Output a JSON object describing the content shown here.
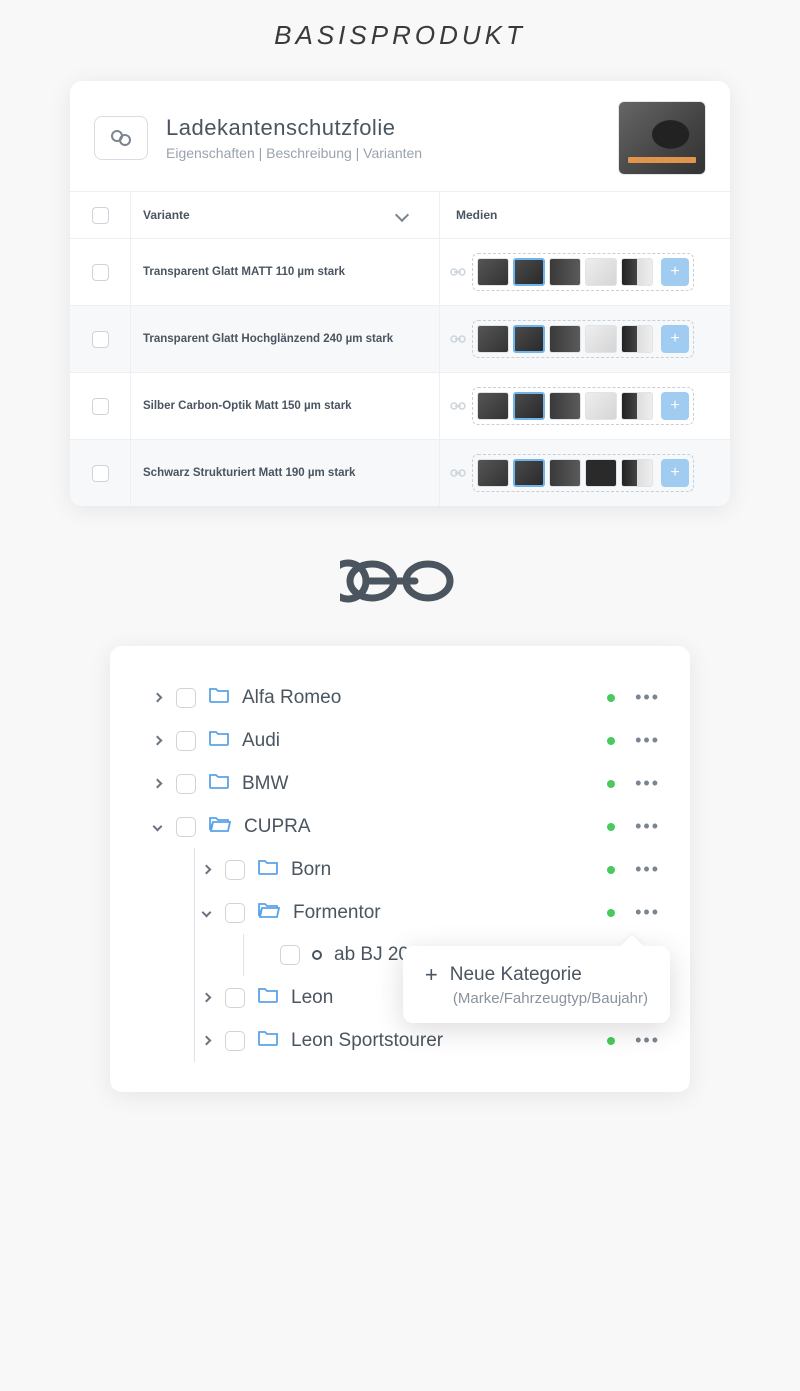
{
  "page": {
    "title": "BASISPRODUKT"
  },
  "product": {
    "title": "Ladekantenschutzfolie",
    "subtitle": "Eigenschaften  |  Beschreibung  |  Varianten"
  },
  "table": {
    "headers": {
      "variant": "Variante",
      "media": "Medien"
    },
    "rows": [
      {
        "name": "Transparent Glatt MATT 110 µm stark"
      },
      {
        "name": "Transparent Glatt Hochglänzend 240 µm stark"
      },
      {
        "name": "Silber Carbon-Optik Matt 150 µm stark"
      },
      {
        "name": "Schwarz Strukturiert Matt 190 µm stark"
      }
    ]
  },
  "tree": {
    "items": [
      {
        "label": "Alfa Romeo"
      },
      {
        "label": "Audi"
      },
      {
        "label": "BMW"
      },
      {
        "label": "CUPRA"
      },
      {
        "label": "Born"
      },
      {
        "label": "Formentor"
      },
      {
        "label": "ab BJ 2020"
      },
      {
        "label": "Leon"
      },
      {
        "label": "Leon Sportstourer"
      }
    ]
  },
  "popover": {
    "title": "Neue Kategorie",
    "subtitle": "(Marke/Fahrzeugtyp/Baujahr)"
  }
}
